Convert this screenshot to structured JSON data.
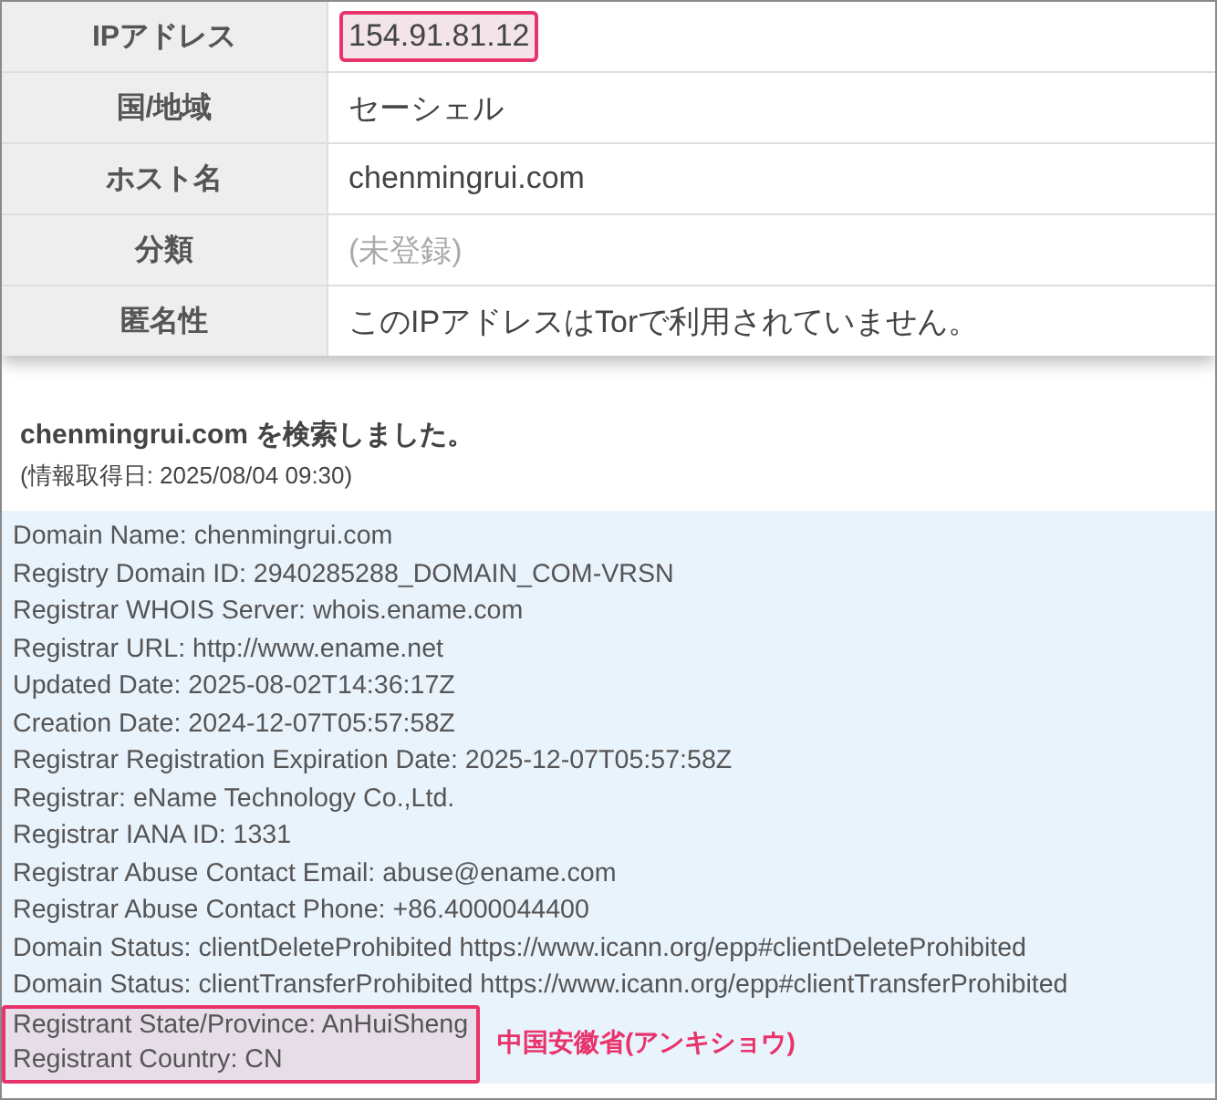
{
  "info_table": [
    {
      "label": "IPアドレス",
      "value": "154.91.81.12",
      "muted": false,
      "highlighted": true
    },
    {
      "label": "国/地域",
      "value": "セーシェル",
      "muted": false,
      "highlighted": false
    },
    {
      "label": "ホスト名",
      "value": "chenmingrui.com",
      "muted": false,
      "highlighted": false
    },
    {
      "label": "分類",
      "value": "(未登録)",
      "muted": true,
      "highlighted": false
    },
    {
      "label": "匿名性",
      "value": "このIPアドレスはTorで利用されていません。",
      "muted": false,
      "highlighted": false
    }
  ],
  "search_heading": "chenmingrui.com を検索しました。",
  "fetched_date": "(情報取得日: 2025/08/04 09:30)",
  "whois": {
    "lines": [
      "Domain Name: chenmingrui.com",
      "Registry Domain ID: 2940285288_DOMAIN_COM-VRSN",
      "Registrar WHOIS Server: whois.ename.com",
      "Registrar URL: http://www.ename.net",
      "Updated Date: 2025-08-02T14:36:17Z",
      "Creation Date: 2024-12-07T05:57:58Z",
      "Registrar Registration Expiration Date: 2025-12-07T05:57:58Z",
      "Registrar: eName Technology Co.,Ltd.",
      "Registrar IANA ID: 1331",
      "Registrar Abuse Contact Email: abuse@ename.com",
      "Registrar Abuse Contact Phone: +86.4000044400",
      "Domain Status: clientDeleteProhibited https://www.icann.org/epp#clientDeleteProhibited",
      "Domain Status: clientTransferProhibited https://www.icann.org/epp#clientTransferProhibited"
    ],
    "highlight": {
      "lines": [
        "Registrant State/Province: AnHuiSheng",
        "Registrant Country: CN"
      ],
      "note": "中国安徽省(アンキショウ)"
    }
  }
}
